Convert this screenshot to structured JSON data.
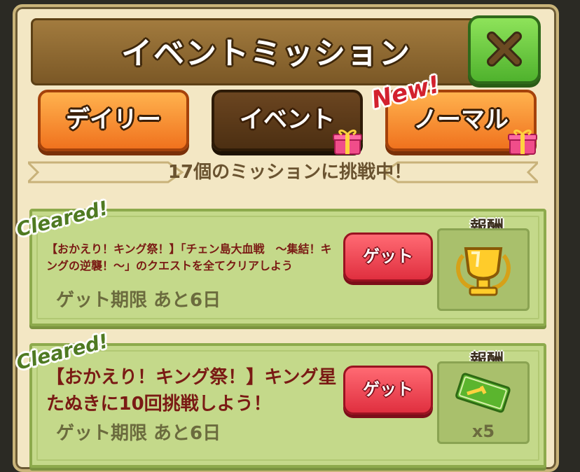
{
  "header": {
    "title": "イベントミッション",
    "close_icon": "close-x-icon"
  },
  "tabs": [
    {
      "label": "デイリー",
      "state": "inactive",
      "gift": false
    },
    {
      "label": "イベント",
      "state": "active",
      "gift": true
    },
    {
      "label": "ノーマル",
      "state": "inactive",
      "gift": true,
      "badge": "New!"
    }
  ],
  "status": {
    "text": "17個のミッションに挑戦中！"
  },
  "missions": [
    {
      "cleared_label": "Cleared!",
      "description": "【おかえり！キング祭！】「チェン島大血戦　～集結！キングの逆襲！～」のクエストを全てクリアしよう",
      "deadline": "ゲット期限  あと6日",
      "button_label": "ゲット",
      "reward_label": "報酬",
      "reward_icon": "golden-trophy-icon",
      "reward_count": ""
    },
    {
      "cleared_label": "Cleared!",
      "description": "【おかえり！キング祭！】キング星たぬきに10回挑戦しよう！",
      "deadline": "ゲット期限  あと6日",
      "button_label": "ゲット",
      "reward_label": "報酬",
      "reward_icon": "green-ticket-icon",
      "reward_count": "x5"
    }
  ],
  "colors": {
    "orange_tab": "#f0721e",
    "active_tab": "#4c2f12",
    "close_button": "#4fb22d",
    "get_button": "#e02f3f",
    "card": "#c4d98a",
    "new_badge": "#d3212e"
  }
}
